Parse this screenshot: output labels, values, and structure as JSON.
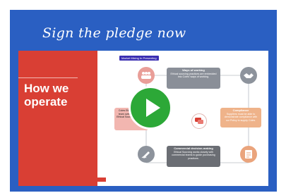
{
  "header": {
    "title": "Sign the pledge now"
  },
  "slide": {
    "heading": "How we operate",
    "badge": "Market Mixing In Presenting",
    "boxes": {
      "top": {
        "title": "Ways of working",
        "text": "Ethical sourcing practices are embedded into Coles' ways of working."
      },
      "left": {
        "title": "",
        "text": "Coles Ethical Sourcing team oversight and the Ethical Sourcing Program."
      },
      "right": {
        "title": "Compliance",
        "text": "Suppliers must be able to demonstrate compliance with our Policy to supply Coles."
      },
      "bottom": {
        "title": "Commercial decision-making",
        "text": "Ethical Sourcing works closely with commercial teams to guide purchasing practices."
      }
    },
    "icons": [
      "people-icon",
      "handshake-icon",
      "chat-icon",
      "checklist-icon",
      "pen-signature-icon"
    ]
  },
  "video": {
    "play_icon": "play-icon",
    "accent": "#2ca837"
  },
  "colors": {
    "brand_blue": "#2a5fc2",
    "brand_red": "#d93f34"
  }
}
